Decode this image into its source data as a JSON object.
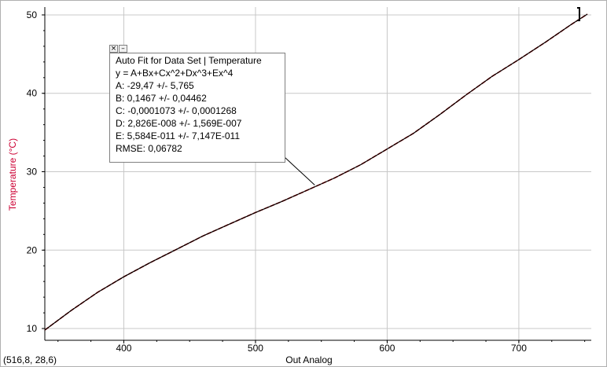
{
  "chart_data": {
    "type": "line",
    "xlabel": "Out Analog",
    "ylabel": "Temperature (°C)",
    "xlim": [
      340,
      755
    ],
    "ylim": [
      8.5,
      51
    ],
    "xticks": [
      400,
      500,
      600,
      700
    ],
    "yticks": [
      10,
      20,
      30,
      40,
      50
    ],
    "grid": true,
    "series": [
      {
        "style": "data",
        "color": "#cc0000",
        "x": [
          340,
          360,
          380,
          400,
          420,
          440,
          460,
          480,
          500,
          520,
          540,
          560,
          580,
          600,
          620,
          640,
          660,
          680,
          700,
          720,
          740,
          752
        ],
        "y": [
          9.8,
          12.3,
          14.6,
          16.6,
          18.4,
          20.1,
          21.8,
          23.3,
          24.8,
          26.2,
          27.7,
          29.2,
          30.9,
          32.9,
          34.9,
          37.3,
          39.8,
          42.2,
          44.3,
          46.5,
          48.8,
          50.1
        ]
      },
      {
        "style": "fit",
        "color": "#000000",
        "x": [
          340,
          360,
          380,
          400,
          420,
          440,
          460,
          480,
          500,
          520,
          540,
          560,
          580,
          600,
          620,
          640,
          660,
          680,
          700,
          720,
          740,
          752
        ],
        "y": [
          9.8,
          12.3,
          14.6,
          16.6,
          18.4,
          20.1,
          21.8,
          23.3,
          24.8,
          26.2,
          27.7,
          29.2,
          30.9,
          32.9,
          34.9,
          37.3,
          39.8,
          42.2,
          44.3,
          46.5,
          48.8,
          50.1
        ]
      }
    ],
    "annotation_anchor": [
      545,
      28.3
    ]
  },
  "fit_box": {
    "title": "Auto Fit for  Data Set | Temperature",
    "equation": "y = A+Bx+Cx^2+Dx^3+Ex^4",
    "params": [
      "A: -29,47 +/- 5,765",
      "B: 0,1467 +/- 0,04462",
      "C: -0,0001073 +/- 0,0001268",
      "D: 2,826E-008 +/- 1,569E-007",
      "E: 5,584E-011 +/- 7,147E-011"
    ],
    "rmse": "RMSE: 0,06782",
    "close_glyph": "×",
    "minimize_glyph": "–"
  },
  "coord_readout": "(516,8, 28,6)",
  "colors": {
    "ylabel": "#cc0033",
    "grid": "#c8c8c8",
    "data": "#cc0000",
    "fit": "#000000"
  }
}
